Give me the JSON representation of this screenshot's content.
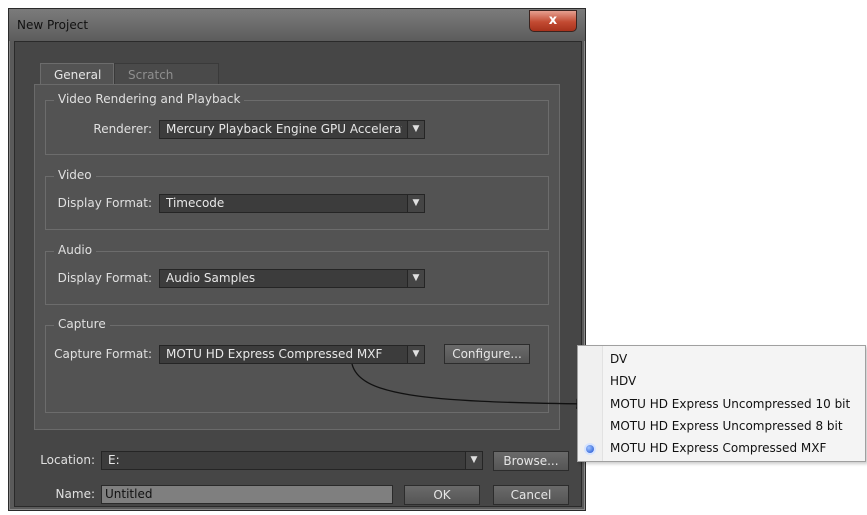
{
  "dialog": {
    "title": "New Project",
    "close_label": "x"
  },
  "tabs": [
    {
      "label": "General",
      "active": true
    },
    {
      "label": "Scratch Disks",
      "active": false
    }
  ],
  "groups": {
    "video_rendering": {
      "title": "Video Rendering and Playback",
      "renderer_label": "Renderer:",
      "renderer_value": "Mercury Playback Engine GPU Accelerat..."
    },
    "video": {
      "title": "Video",
      "display_format_label": "Display Format:",
      "display_format_value": "Timecode"
    },
    "audio": {
      "title": "Audio",
      "display_format_label": "Display Format:",
      "display_format_value": "Audio Samples"
    },
    "capture": {
      "title": "Capture",
      "capture_format_label": "Capture Format:",
      "capture_format_value": "MOTU HD Express Compressed MXF",
      "configure_label": "Configure..."
    }
  },
  "location": {
    "label": "Location:",
    "value": "E:",
    "browse_label": "Browse..."
  },
  "name": {
    "label": "Name:",
    "value": "Untitled"
  },
  "footer": {
    "ok_label": "OK",
    "cancel_label": "Cancel"
  },
  "dropdown_options": [
    {
      "label": "DV",
      "selected": false
    },
    {
      "label": "HDV",
      "selected": false
    },
    {
      "label": "MOTU HD Express Uncompressed 10 bit",
      "selected": false
    },
    {
      "label": "MOTU HD Express Uncompressed 8 bit",
      "selected": false
    },
    {
      "label": "MOTU HD Express Compressed MXF",
      "selected": true
    }
  ],
  "icons": {
    "dropdown_arrow": "▼",
    "radio_dot": "radio-selected-icon"
  },
  "colors": {
    "dialog_bg": "#464646",
    "panel_bg": "#535353",
    "titlebar_text": "#111111",
    "close_button": "#c24a32",
    "selection_blue": "#1a4fd0"
  }
}
